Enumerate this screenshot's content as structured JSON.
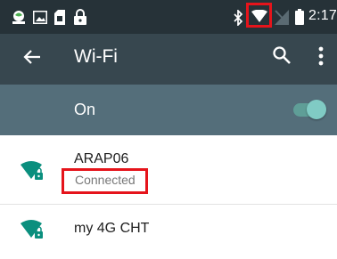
{
  "status_bar": {
    "time": "2:17",
    "icons": [
      "notification-icon",
      "image-icon",
      "sim-icon",
      "lock-icon",
      "bluetooth-icon",
      "wifi-signal-icon",
      "cell-signal-icon",
      "battery-icon"
    ]
  },
  "app_bar": {
    "title": "Wi-Fi",
    "icons": [
      "back-arrow-icon",
      "search-icon",
      "overflow-menu-icon"
    ]
  },
  "master_switch": {
    "label": "On",
    "state": "on"
  },
  "networks": [
    {
      "ssid": "ARAP06",
      "status": "Connected",
      "secured": true
    },
    {
      "ssid": "my 4G CHT",
      "secured": true
    }
  ],
  "colors": {
    "status_bar": "#263238",
    "app_bar": "#37474f",
    "switch_bar": "#546e7a",
    "accent": "#009688",
    "highlight": "#e5141b"
  }
}
